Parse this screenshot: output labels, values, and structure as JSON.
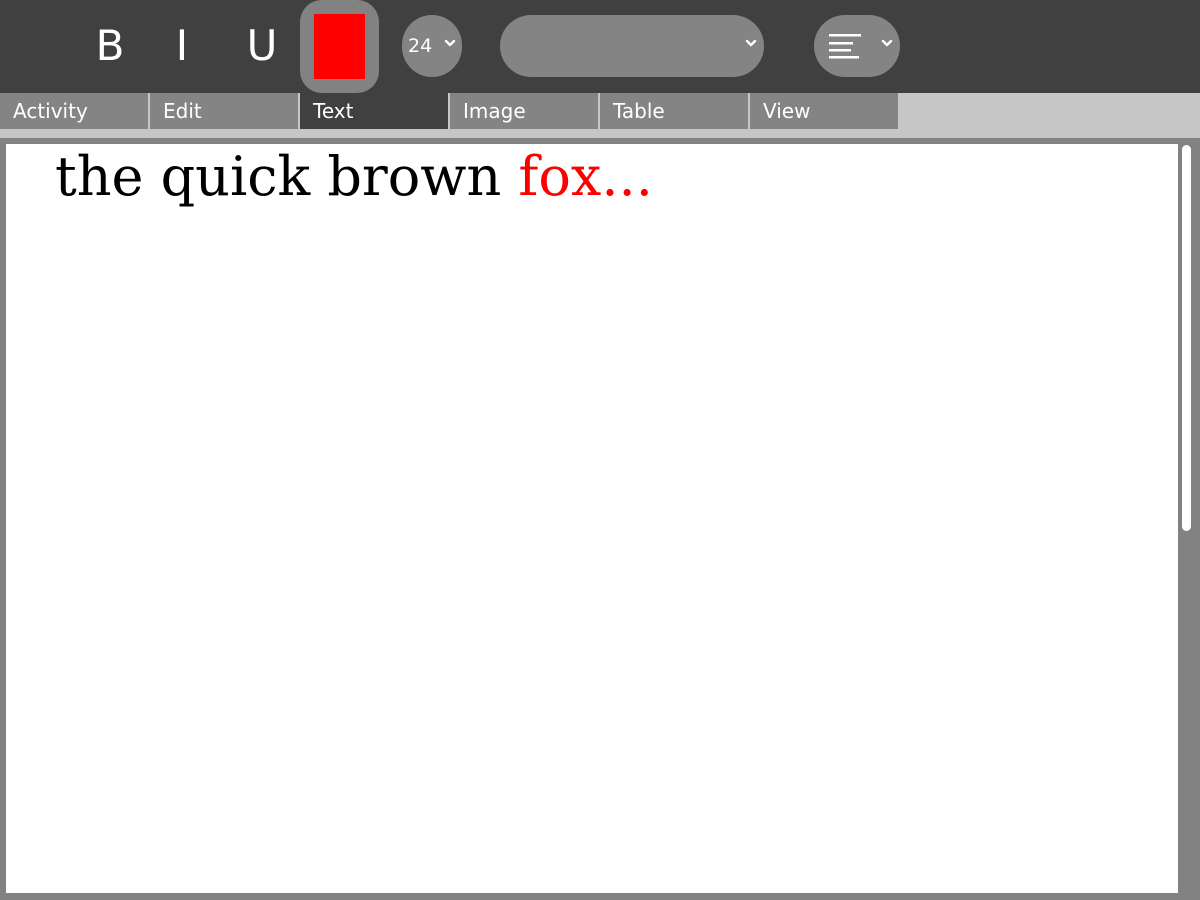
{
  "toolbar": {
    "bold_label": "B",
    "italic_label": "I",
    "underline_label": "U",
    "text_color": "#ff0000",
    "font_size": "24",
    "font_family": "",
    "align_icon": "align-left-icon"
  },
  "tabs": [
    {
      "label": "Activity"
    },
    {
      "label": "Edit"
    },
    {
      "label": "Text",
      "active": true
    },
    {
      "label": "Image"
    },
    {
      "label": "Table"
    },
    {
      "label": "View"
    }
  ],
  "document": {
    "text_plain": "the quick brown ",
    "text_colored": "fox...",
    "colored_text_color": "#ff0000"
  }
}
